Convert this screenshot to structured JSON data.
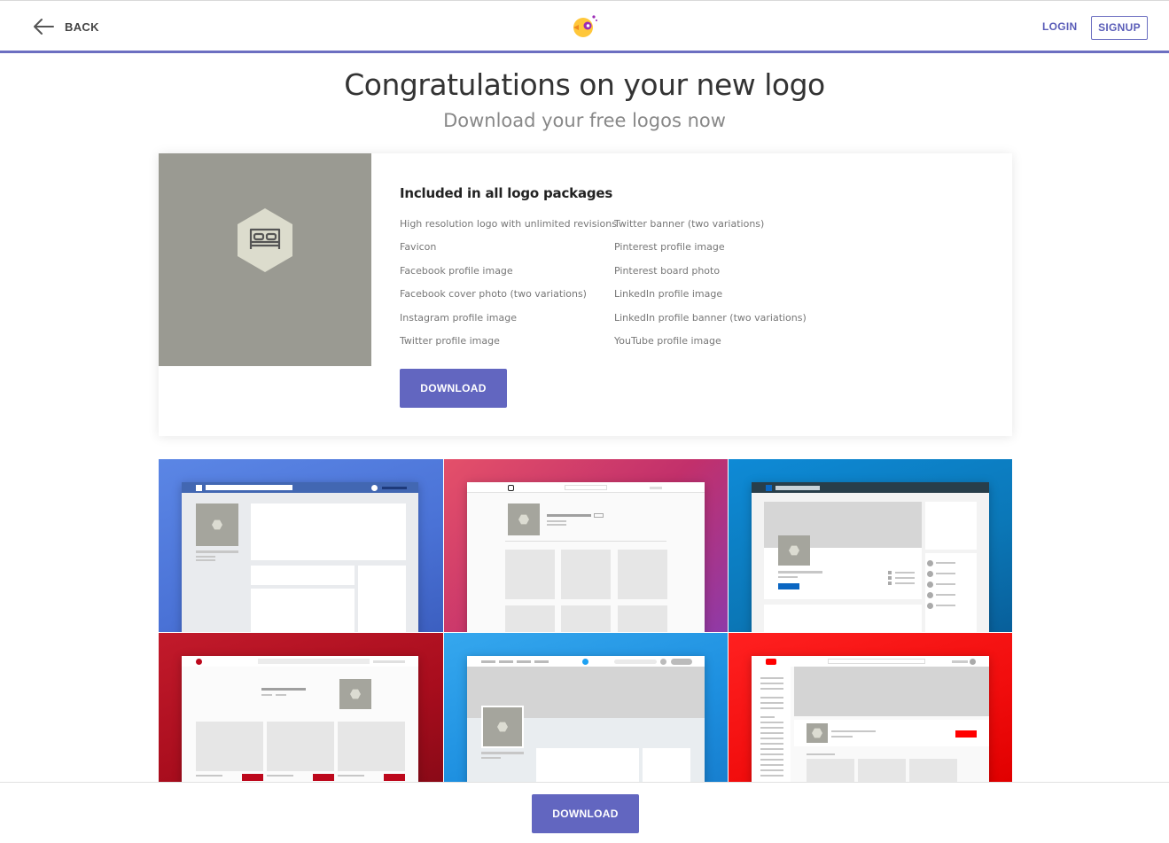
{
  "header": {
    "back_label": "BACK",
    "login_label": "LOGIN",
    "signup_label": "SIGNUP"
  },
  "main": {
    "title": "Congratulations on your new logo",
    "subtitle": "Download your free logos now"
  },
  "package": {
    "title": "Included in all logo packages",
    "items_left": [
      "High resolution logo with unlimited revisions",
      "Favicon",
      "Facebook profile image",
      "Facebook cover photo (two variations)",
      "Instagram profile image",
      "Twitter profile image"
    ],
    "items_right": [
      "Twitter banner (two variations)",
      "Pinterest profile image",
      "Pinterest board photo",
      "LinkedIn profile image",
      "LinkedIn profile banner (two variations)",
      "YouTube profile image"
    ],
    "download_label": "DOWNLOAD"
  },
  "previews": [
    {
      "name": "facebook-preview",
      "color": "#4a72d6"
    },
    {
      "name": "instagram-preview",
      "color": "#c2306b"
    },
    {
      "name": "linkedin-preview",
      "color": "#0b77b7"
    },
    {
      "name": "pinterest-preview",
      "color": "#a80d1d"
    },
    {
      "name": "twitter-preview",
      "color": "#1e90e0"
    },
    {
      "name": "youtube-preview",
      "color": "#f10d0d"
    }
  ],
  "footer": {
    "download_label": "DOWNLOAD"
  },
  "colors": {
    "accent": "#6266c0",
    "logo_bg": "#9a9a92"
  }
}
